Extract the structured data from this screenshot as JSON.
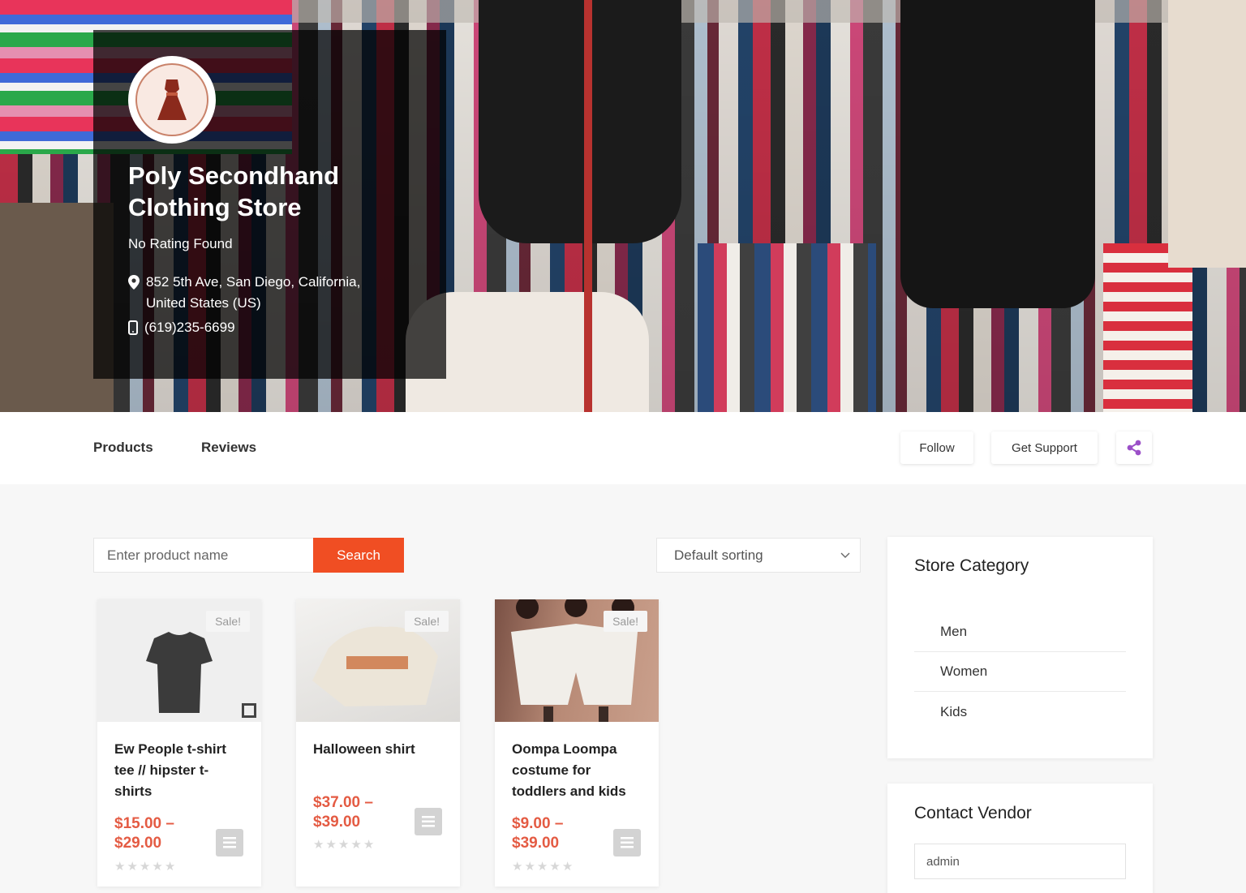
{
  "store": {
    "name": "Poly Secondhand Clothing Store",
    "rating": "No Rating Found",
    "address": "852 5th Ave, San Diego, California, United States (US)",
    "phone": "(619)235-6699",
    "logo_icon": "dress-logo-icon"
  },
  "tabs": {
    "products": "Products",
    "reviews": "Reviews"
  },
  "actions": {
    "follow": "Follow",
    "support": "Get Support",
    "share_icon": "share-icon"
  },
  "search": {
    "placeholder": "Enter product name",
    "button": "Search"
  },
  "sorting": {
    "selected": "Default sorting"
  },
  "products": [
    {
      "title": "Ew People t-shirt tee // hipster t-shirts",
      "price": "$15.00 – $29.00",
      "badge": "Sale!",
      "rating": 0
    },
    {
      "title": "Halloween shirt",
      "price": "$37.00 – $39.00",
      "badge": "Sale!",
      "rating": 0
    },
    {
      "title": "Oompa Loompa costume for toddlers and kids",
      "price": "$9.00 – $39.00",
      "badge": "Sale!",
      "rating": 0
    }
  ],
  "sidebar": {
    "category_title": "Store Category",
    "categories": [
      "Men",
      "Women",
      "Kids"
    ],
    "contact_title": "Contact Vendor",
    "contact_name_value": "admin"
  },
  "colors": {
    "accent": "#f04e23",
    "price": "#e45b43",
    "share": "#9b4fc8"
  }
}
